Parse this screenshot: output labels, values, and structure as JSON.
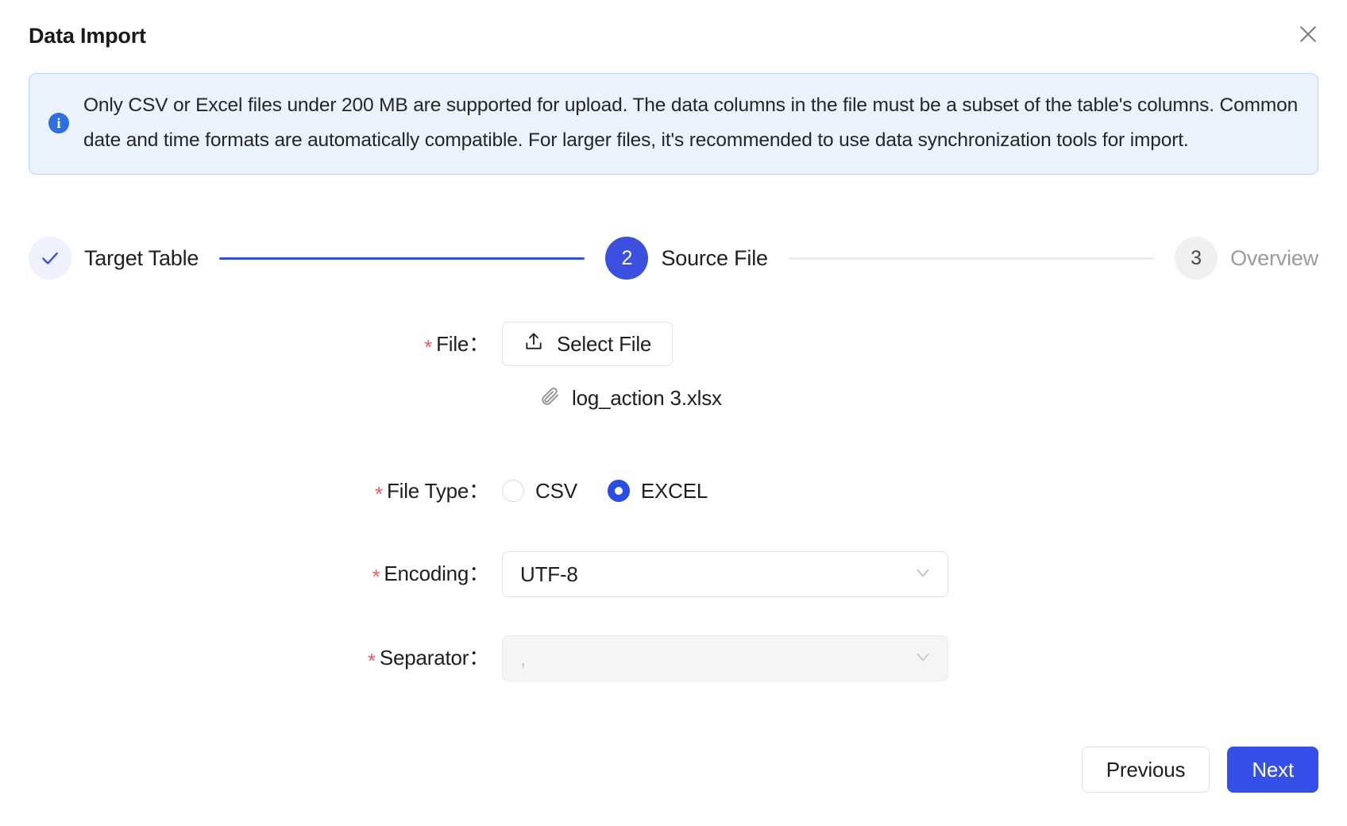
{
  "dialog": {
    "title": "Data Import",
    "close_icon": "close-icon"
  },
  "banner": {
    "icon": "info-icon",
    "icon_glyph": "i",
    "text": "Only CSV or Excel files under 200 MB are supported for upload. The data columns in the file must be a subset of the table's columns. Common date and time formats are automatically compatible. For larger files, it's recommended to use data synchronization tools for import.",
    "background_color": "#eaf3fe",
    "border_color": "#b7d9fb",
    "icon_color": "#2b6fe0"
  },
  "stepper": {
    "steps": [
      {
        "indicator": "✓",
        "label": "Target Table",
        "state": "done"
      },
      {
        "indicator": "2",
        "label": "Source File",
        "state": "active"
      },
      {
        "indicator": "3",
        "label": "Overview",
        "state": "todo"
      }
    ],
    "active_color": "#3b4fe0",
    "done_color": "#3550e8",
    "todo_color": "#9b9b9b"
  },
  "form": {
    "required_marker": "*",
    "file": {
      "label": "File：",
      "button_label": "Select File",
      "button_icon": "upload-icon",
      "selected_file_name": "log_action 3.xlsx",
      "file_icon": "paperclip-icon"
    },
    "file_type": {
      "label": "File Type：",
      "options": [
        {
          "label": "CSV",
          "selected": false
        },
        {
          "label": "EXCEL",
          "selected": true
        }
      ],
      "selected_color": "#2a4ce8"
    },
    "encoding": {
      "label": "Encoding：",
      "value": "UTF-8",
      "chevron_icon": "chevron-down-icon"
    },
    "separator": {
      "label": "Separator：",
      "value": "",
      "placeholder": ",",
      "disabled": true,
      "chevron_icon": "chevron-down-icon"
    }
  },
  "footer": {
    "previous_label": "Previous",
    "next_label": "Next",
    "primary_color": "#3550e8"
  }
}
